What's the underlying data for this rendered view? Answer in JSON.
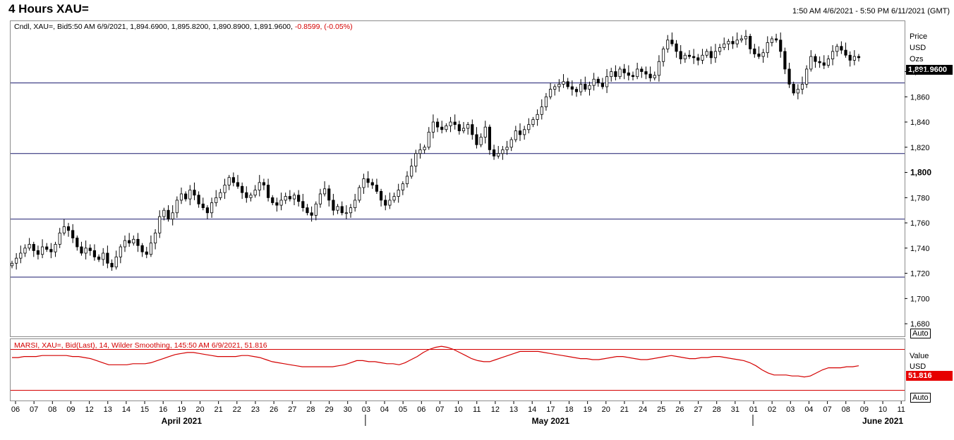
{
  "header": {
    "title": "4 Hours XAU=",
    "date_range": "1:50 AM 4/6/2021 - 5:50 PM 6/11/2021 (GMT)"
  },
  "legend": {
    "main_prefix": "Cndl, XAU=, Bid5:50 AM 6/9/2021, 1,894.6900, 1,895.8200, 1,890.8900, 1,891.9600,",
    "main_change": "-0.8599, (-0.05%)",
    "rsi": "MARSI, XAU=, Bid(Last),   14, Wilder Smoothing, 145:50 AM 6/9/2021, 51.816"
  },
  "price_axis": {
    "label_line1": "Price",
    "label_line2": "USD",
    "label_line3": "Ozs",
    "last_price_tag": "1,891.9600",
    "auto": "Auto"
  },
  "rsi_axis": {
    "label_line1": "Value",
    "label_line2": "USD",
    "value_tag": "51.816",
    "auto": "Auto"
  },
  "colors": {
    "candle": "#000000",
    "rsi_line": "#d40000",
    "rsi_band": "#d40000",
    "hline": "#1a1a6e",
    "tag_bg": "#000000",
    "rsi_tag_bg": "#e60000"
  },
  "chart_data": [
    {
      "type": "candlestick",
      "title": "4 Hours XAU=",
      "ylim": [
        1670,
        1920
      ],
      "y_ticks": [
        1680,
        1700,
        1720,
        1740,
        1760,
        1780,
        1800,
        1820,
        1840,
        1860,
        1880
      ],
      "y_tick_labels": [
        "1,680",
        "1,700",
        "1,720",
        "1,740",
        "1,760",
        "1,780",
        "1,800",
        "1,820",
        "1,840",
        "1,860",
        "1,880"
      ],
      "horizontal_lines": [
        1871,
        1815,
        1763,
        1717
      ],
      "x_day_labels": [
        "06",
        "07",
        "08",
        "09",
        "12",
        "13",
        "14",
        "15",
        "16",
        "19",
        "20",
        "21",
        "22",
        "23",
        "26",
        "27",
        "28",
        "29",
        "30",
        "03",
        "04",
        "05",
        "06",
        "07",
        "10",
        "11",
        "12",
        "13",
        "14",
        "17",
        "18",
        "19",
        "20",
        "21",
        "24",
        "25",
        "26",
        "27",
        "28",
        "31",
        "01",
        "02",
        "03",
        "04",
        "07",
        "08",
        "09",
        "10",
        "11"
      ],
      "month_labels": [
        "April 2021",
        "May 2021",
        "June 2021"
      ],
      "month_label_day_index": [
        9,
        29,
        47
      ],
      "month_separator_day_index": [
        19,
        40
      ],
      "candles_per_day": 6,
      "closes": [
        1728,
        1732,
        1736,
        1740,
        1743,
        1738,
        1735,
        1741,
        1739,
        1737,
        1743,
        1752,
        1757,
        1754,
        1748,
        1741,
        1736,
        1740,
        1738,
        1733,
        1731,
        1736,
        1728,
        1725,
        1733,
        1741,
        1746,
        1744,
        1747,
        1742,
        1737,
        1735,
        1744,
        1752,
        1765,
        1770,
        1763,
        1768,
        1778,
        1783,
        1779,
        1786,
        1782,
        1775,
        1772,
        1768,
        1776,
        1780,
        1784,
        1790,
        1796,
        1792,
        1789,
        1784,
        1780,
        1782,
        1786,
        1792,
        1790,
        1780,
        1776,
        1774,
        1778,
        1781,
        1779,
        1782,
        1777,
        1772,
        1768,
        1766,
        1775,
        1783,
        1787,
        1778,
        1770,
        1773,
        1768,
        1768,
        1772,
        1778,
        1788,
        1795,
        1792,
        1790,
        1785,
        1778,
        1774,
        1778,
        1781,
        1786,
        1791,
        1797,
        1805,
        1815,
        1818,
        1820,
        1832,
        1840,
        1836,
        1834,
        1837,
        1840,
        1838,
        1833,
        1835,
        1838,
        1830,
        1822,
        1828,
        1836,
        1818,
        1813,
        1815,
        1818,
        1820,
        1826,
        1833,
        1830,
        1834,
        1838,
        1842,
        1846,
        1852,
        1860,
        1866,
        1868,
        1870,
        1872,
        1868,
        1866,
        1864,
        1870,
        1866,
        1869,
        1874,
        1871,
        1868,
        1876,
        1880,
        1876,
        1882,
        1879,
        1877,
        1876,
        1882,
        1880,
        1878,
        1875,
        1877,
        1888,
        1898,
        1905,
        1902,
        1896,
        1890,
        1893,
        1892,
        1891,
        1889,
        1893,
        1896,
        1891,
        1896,
        1899,
        1902,
        1904,
        1902,
        1905,
        1906,
        1908,
        1898,
        1894,
        1892,
        1895,
        1903,
        1906,
        1905,
        1896,
        1882,
        1870,
        1863,
        1866,
        1870,
        1882,
        1892,
        1888,
        1887,
        1885,
        1890,
        1896,
        1900,
        1897,
        1893,
        1889,
        1892,
        1891
      ],
      "series": [
        {
          "name": "XAU=",
          "field": "closes"
        }
      ]
    },
    {
      "type": "line",
      "ylim": [
        20,
        80
      ],
      "bands": [
        70,
        30
      ],
      "values": [
        62,
        62,
        63,
        63,
        63,
        64,
        64,
        64,
        64,
        64,
        63,
        63,
        62,
        61,
        59,
        57,
        55,
        55,
        55,
        55,
        56,
        56,
        56,
        57,
        59,
        61,
        63,
        65,
        66,
        67,
        67,
        66,
        65,
        64,
        63,
        63,
        63,
        63,
        64,
        64,
        63,
        62,
        60,
        58,
        57,
        56,
        55,
        54,
        53,
        53,
        53,
        53,
        53,
        53,
        54,
        55,
        57,
        59,
        59,
        58,
        58,
        57,
        56,
        56,
        55,
        57,
        60,
        63,
        67,
        70,
        72,
        73,
        72,
        70,
        67,
        64,
        61,
        59,
        58,
        58,
        60,
        62,
        64,
        66,
        68,
        68,
        68,
        68,
        67,
        66,
        65,
        64,
        63,
        62,
        61,
        61,
        60,
        60,
        61,
        62,
        63,
        63,
        62,
        61,
        60,
        60,
        61,
        62,
        63,
        64,
        63,
        62,
        61,
        61,
        62,
        62,
        63,
        63,
        62,
        61,
        60,
        59,
        57,
        54,
        50,
        47,
        45,
        45,
        45,
        44,
        44,
        43,
        44,
        47,
        50,
        52,
        52,
        52,
        53,
        53,
        54
      ],
      "series": [
        {
          "name": "MARSI",
          "field": "values"
        }
      ]
    }
  ]
}
